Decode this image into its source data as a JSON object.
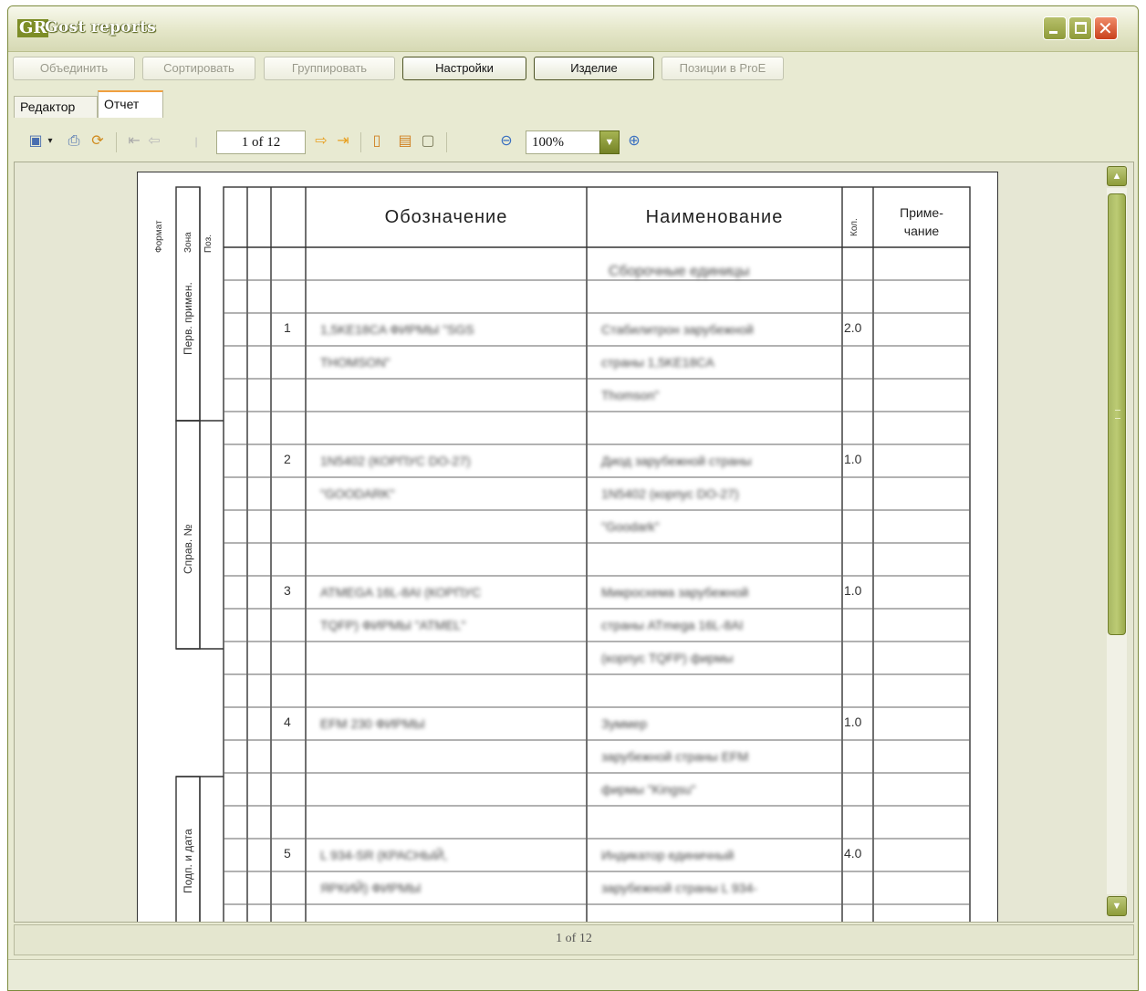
{
  "window": {
    "title": "Gost reports",
    "logo": "GR"
  },
  "commands": {
    "merge": "Объединить",
    "sort": "Сортировать",
    "group": "Группировать",
    "settings": "Настройки",
    "product": "Изделие",
    "positions": "Позиции в ProE"
  },
  "tabs": {
    "editor": "Редактор",
    "report": "Отчет"
  },
  "toolbar": {
    "page": "1 of 12",
    "zoom": "100%",
    "icons": [
      "save-icon",
      "print-icon",
      "refresh-icon",
      "first-page-icon",
      "prev-page-icon",
      "next-page-icon",
      "last-page-icon",
      "single-page-icon",
      "page-width-icon",
      "whole-page-icon",
      "zoom-out-icon",
      "zoom-in-icon"
    ]
  },
  "status": {
    "page": "1 of 12"
  },
  "report": {
    "headers": {
      "format": "Формат",
      "zone": "Зона",
      "pos": "Поз.",
      "designation": "Обозначение",
      "name": "Наименование",
      "qty": "Кол.",
      "note_line1": "Приме-",
      "note_line2": "чание"
    },
    "side_labels": {
      "first_use": "Перв. примен.",
      "ref_no": "Справ. №",
      "sign_date": "Подп. и дата"
    },
    "section_title": "Сборочные единицы",
    "items": [
      {
        "pos": "1",
        "designation": [
          "1,5KE18CA ФИРМЫ \"SGS",
          "THOMSON\""
        ],
        "name": [
          "Стабилитрон зарубежной",
          "страны 1,5KE18CA",
          "Thomson\""
        ],
        "qty": "2.0"
      },
      {
        "pos": "2",
        "designation": [
          "1N5402 (КОРПУС DO-27)",
          "\"GOODARK\""
        ],
        "name": [
          "Диод зарубежной страны",
          "1N5402 (корпус DO-27)",
          "\"Goodark\""
        ],
        "qty": "1.0"
      },
      {
        "pos": "3",
        "designation": [
          "ATMEGA 16L-8AI (КОРПУС",
          "TQFP) ФИРМЫ \"ATMEL\""
        ],
        "name": [
          "Микросхема зарубежной",
          "страны ATmega 16L-8AI",
          "(корпус TQFP) фирмы"
        ],
        "qty": "1.0"
      },
      {
        "pos": "4",
        "designation": [
          "EFM 230 ФИРМЫ"
        ],
        "name": [
          "Зуммер",
          "зарубежной страны EFM",
          "фирмы \"Kingsu\""
        ],
        "qty": "1.0"
      },
      {
        "pos": "5",
        "designation": [
          "L 934-SR (КРАСНЫЙ,",
          "ЯРКИЙ) ФИРМЫ"
        ],
        "name": [
          "Индикатор единичный",
          "зарубежной страны L 934-"
        ],
        "qty": "4.0"
      }
    ]
  }
}
